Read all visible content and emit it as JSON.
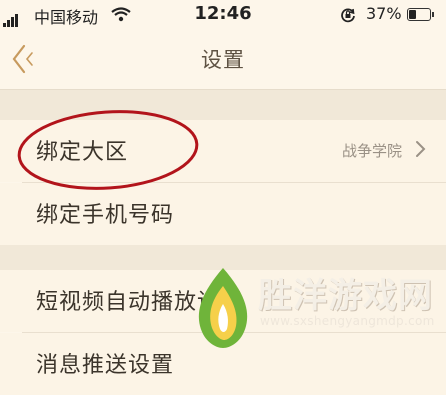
{
  "status_bar": {
    "carrier": "中国移动",
    "time": "12:46",
    "battery_percent": "37%",
    "battery_level": 0.37,
    "icons": [
      "signal-icon",
      "wifi-icon",
      "orientation-lock-icon",
      "battery-icon"
    ]
  },
  "nav": {
    "title": "设置",
    "back_icon": "chevron-left-icon"
  },
  "settings": {
    "group1": [
      {
        "label": "绑定大区",
        "value": "战争学院",
        "chevron": true
      },
      {
        "label": "绑定手机号码"
      }
    ],
    "group2": [
      {
        "label": "短视频自动播放设置"
      },
      {
        "label": "消息推送设置"
      }
    ]
  },
  "annotation": {
    "shape": "ellipse",
    "color": "#b2141b"
  },
  "watermark": {
    "text": "胜洋游戏网",
    "url": "www.sxshengyangmdp.com"
  },
  "colors": {
    "background": "#fdf6ea",
    "row_background": "#fcf4e6",
    "accent": "#c79a5e"
  }
}
